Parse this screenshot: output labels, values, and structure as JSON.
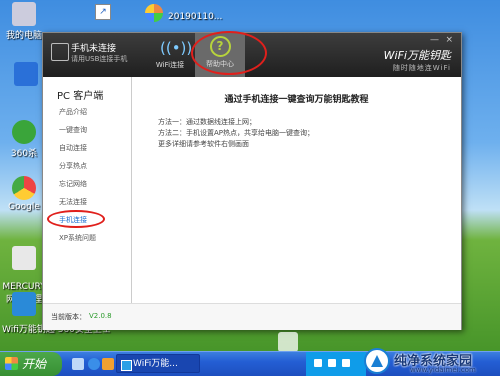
{
  "desktop": {
    "icons": [
      {
        "label": "我的电脑"
      },
      {
        "label": ""
      },
      {
        "label": "360杀"
      },
      {
        "label": "Google"
      },
      {
        "label": "MERCURY\n网卡管理"
      },
      {
        "label": "WiFi万能钥"
      }
    ],
    "bottom_label": "Wifi万能钥匙  360安全卫士",
    "top_strip_text": "20190110..."
  },
  "window": {
    "status_title": "手机未连接",
    "status_sub": "请用USB连接手机",
    "tabs": [
      {
        "label": "WiFi连接",
        "icon": "wifi-icon"
      },
      {
        "label": "帮助中心",
        "icon": "question-icon"
      }
    ],
    "brand_name": "WiFi万能钥匙",
    "brand_sub": "随时随地连WiFi",
    "controls": {
      "minimize": "—",
      "close": "×"
    },
    "sidebar": {
      "title": "PC 客户端",
      "items": [
        "产品介绍",
        "一键查询",
        "自动连接",
        "分享热点",
        "忘记网络",
        "无法连接",
        "手机连接",
        "XP系统问题"
      ],
      "active_index": 6
    },
    "content": {
      "title": "通过手机连接一键查询万能钥匙教程",
      "lines": [
        "方法一：通过数据线连接上网；",
        "方法二：手机设置AP热点，共享给电脑一键查询；",
        "更多详细请参考软件右侧画面"
      ]
    },
    "footer": {
      "version_label": "当前版本：",
      "version_value": "V2.0.8"
    }
  },
  "taskbar": {
    "start_label": "开始",
    "task_label": "WiFi万能..."
  },
  "watermark": {
    "main": "纯净系统家园",
    "url": "www.yidaimei.com"
  },
  "colors": {
    "highlight_circle": "#e0201c",
    "active_link": "#1a6fd0",
    "version": "#2a9a2a"
  }
}
